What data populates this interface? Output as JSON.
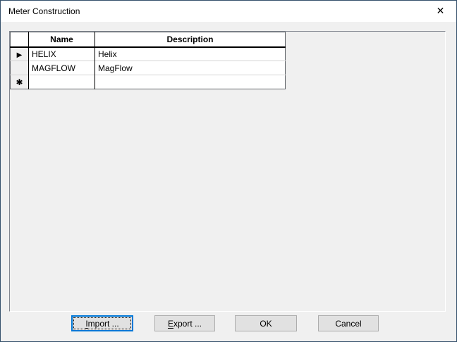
{
  "window": {
    "title": "Meter Construction",
    "close_icon": "✕"
  },
  "colors": {
    "dialog_border": "#34506b",
    "titlebar_bg": "#ffffff",
    "body_bg": "#f0f0f0",
    "cell_bg": "#ffffff",
    "button_bg": "#e1e1e1",
    "button_border": "#adadad",
    "focus_accent": "#0078d7"
  },
  "grid": {
    "columns": [
      {
        "label": "Name"
      },
      {
        "label": "Description"
      }
    ],
    "row_indicator_current": "▶",
    "row_indicator_new": "✱",
    "rows": [
      {
        "name": "HELIX",
        "description": "Helix"
      },
      {
        "name": "MAGFLOW",
        "description": "MagFlow"
      },
      {
        "name": "",
        "description": ""
      }
    ]
  },
  "buttons": {
    "import": {
      "key": "I",
      "rest": "mport ..."
    },
    "export": {
      "key": "E",
      "rest": "xport ..."
    },
    "ok": {
      "label": "OK"
    },
    "cancel": {
      "label": "Cancel"
    }
  }
}
